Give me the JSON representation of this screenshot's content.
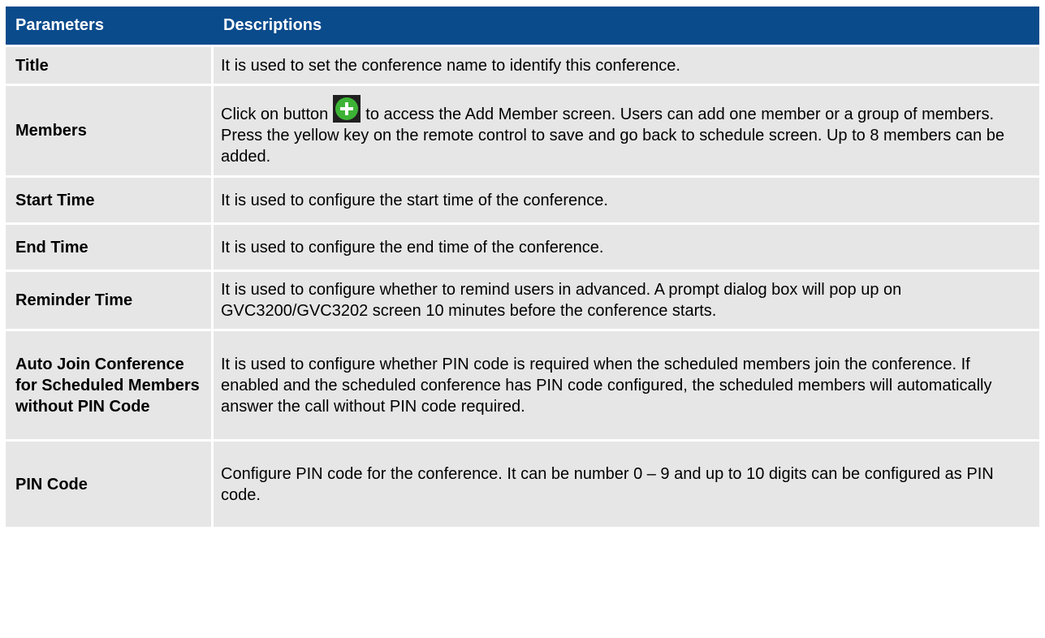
{
  "header": {
    "parameters": "Parameters",
    "descriptions": "Descriptions"
  },
  "rows": [
    {
      "param": "Title",
      "desc": "It is used to set the conference name to identify this conference."
    },
    {
      "param": "Members",
      "desc_before_icon": "Click on button",
      "icon": "add-green-plus-icon",
      "desc_after_icon": "to access the Add Member screen. Users can add one member or a group of members. Press the yellow key on the remote control to save and go back to schedule screen. Up to 8 members can be added."
    },
    {
      "param": "Start Time",
      "desc": "It is used to configure the start time of the conference."
    },
    {
      "param": "End Time",
      "desc": "It is used to configure the end time of the conference."
    },
    {
      "param": "Reminder Time",
      "desc": "It is used to configure whether to remind users in advanced. A prompt dialog box will pop up on GVC3200/GVC3202 screen 10 minutes before the conference starts."
    },
    {
      "param": "Auto Join Conference for Scheduled Members without PIN Code",
      "desc": "It is used to configure whether PIN code is required when the scheduled members join the conference. If enabled and the scheduled conference has PIN code configured, the scheduled members will automatically answer the call without PIN code required."
    },
    {
      "param": "PIN Code",
      "desc": "Configure PIN code for the conference. It can be number 0 – 9 and up to 10 digits can be configured as PIN code."
    }
  ],
  "colors": {
    "header_bg": "#0a4b8c",
    "row_bg": "#e6e6e6",
    "icon_green": "#3db336"
  }
}
